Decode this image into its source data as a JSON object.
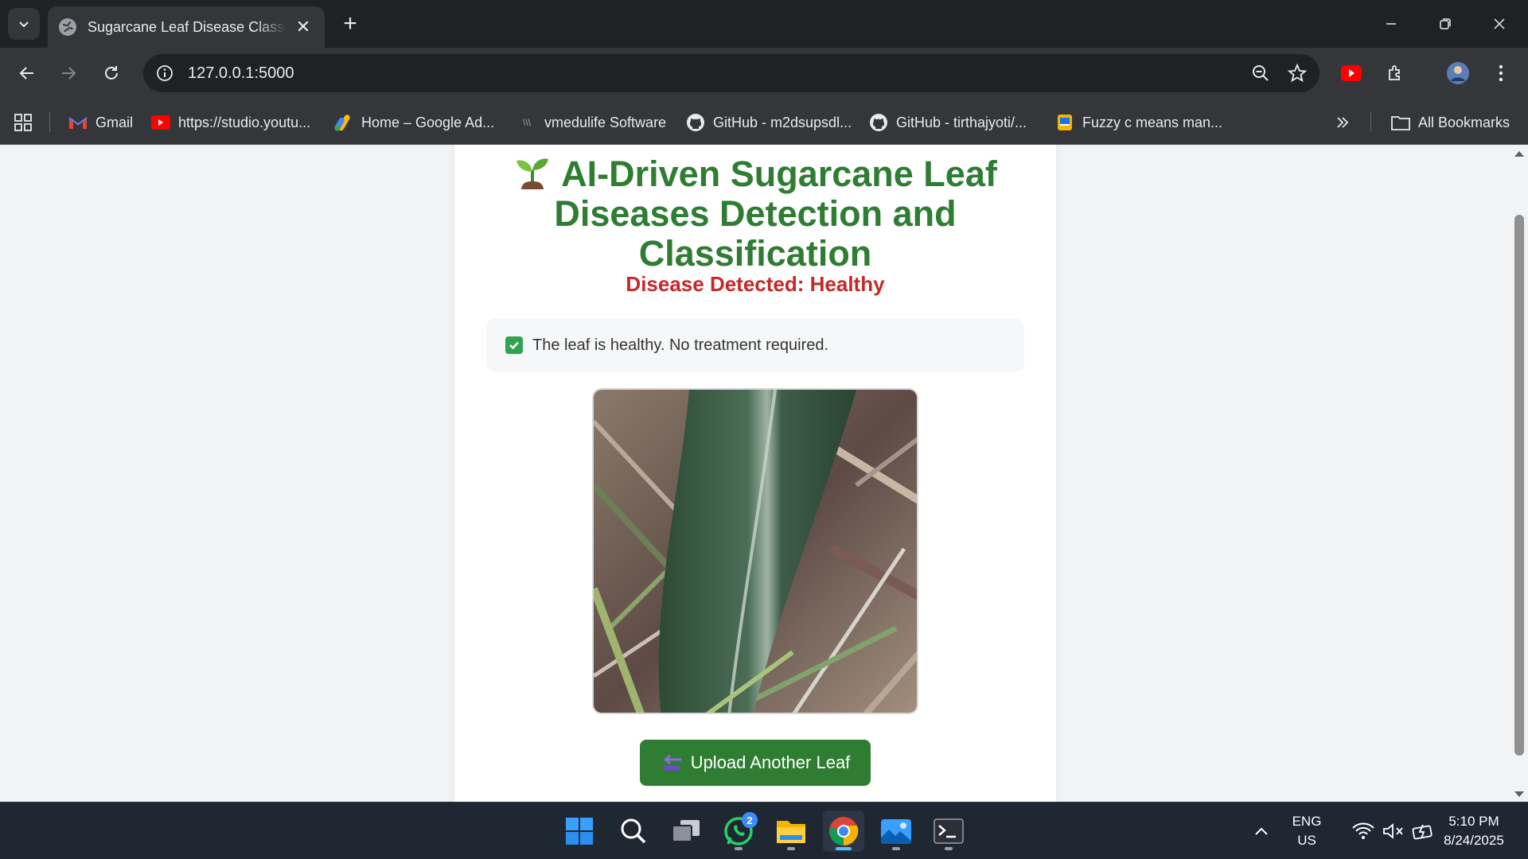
{
  "browser": {
    "tab_title": "Sugarcane Leaf Disease Classification",
    "url": "127.0.0.1:5000",
    "bookmarks": [
      {
        "label": "Gmail",
        "icon": "gmail-icon"
      },
      {
        "label": "https://studio.youtu...",
        "icon": "youtube-icon"
      },
      {
        "label": "Home – Google Ad...",
        "icon": "google-ads-icon"
      },
      {
        "label": "vmedulife Software",
        "icon": "vmedulife-icon"
      },
      {
        "label": "GitHub - m2dsupsdl...",
        "icon": "github-icon"
      },
      {
        "label": "GitHub - tirthajyoti/...",
        "icon": "github-icon"
      },
      {
        "label": "Fuzzy c means man...",
        "icon": "document-icon"
      }
    ],
    "all_bookmarks_label": "All Bookmarks"
  },
  "page": {
    "title": "AI-Driven Sugarcane Leaf Diseases Detection and Classification",
    "title_lines": [
      "AI-Driven Sugarcane Leaf",
      "Diseases Detection and",
      "Classification"
    ],
    "result_text": "Disease Detected: Healthy",
    "treatment_text": "The leaf is healthy. No treatment required.",
    "upload_button_label": "Upload Another Leaf",
    "colors": {
      "primary": "#2e7d32",
      "result": "#c62828"
    }
  },
  "taskbar": {
    "whatsapp_badge": "2",
    "language": "ENG",
    "region": "US",
    "time": "5:10 PM",
    "date": "8/24/2025"
  }
}
